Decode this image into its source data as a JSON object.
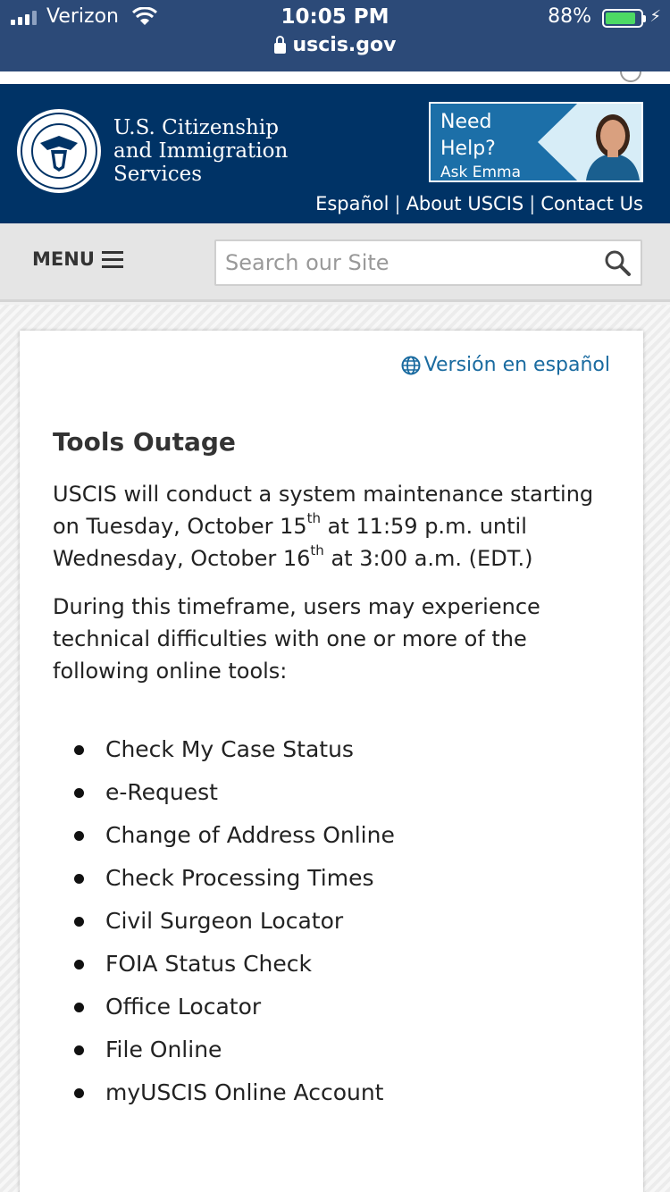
{
  "status_bar": {
    "carrier": "Verizon",
    "time": "10:05 PM",
    "battery_percent": "88%",
    "battery_level": 0.88,
    "url": "uscis.gov"
  },
  "header": {
    "agency_line1": "U.S. Citizenship",
    "agency_line2": "and Immigration",
    "agency_line3": "Services",
    "help_line1": "Need",
    "help_line2": "Help?",
    "help_line3": "Ask Emma",
    "links": [
      "Español",
      "About USCIS",
      "Contact Us"
    ],
    "link_separator": "|"
  },
  "nav": {
    "menu_label": "MENU",
    "search_placeholder": "Search our Site"
  },
  "content": {
    "spanish_link": "Versión en español",
    "title": "Tools Outage",
    "para1_a": "USCIS will conduct a system maintenance starting on Tuesday, October 15",
    "para1_sup1": "th",
    "para1_b": " at 11:59 p.m. until Wednesday, October 16",
    "para1_sup2": "th",
    "para1_c": " at 3:00 a.m. (EDT.)",
    "para2": "During this timeframe, users may experience technical difficulties with one or more of the following online tools:",
    "tools": [
      "Check My Case Status",
      "e-Request",
      "Change of Address Online",
      "Check Processing Times",
      "Civil Surgeon Locator",
      "FOIA Status Check",
      "Office Locator",
      "File Online",
      "myUSCIS Online Account"
    ]
  },
  "colors": {
    "status_bar": "#2c4a78",
    "header_bg": "#003366",
    "help_bg": "#1c6fa8",
    "link": "#1a6ba0"
  }
}
